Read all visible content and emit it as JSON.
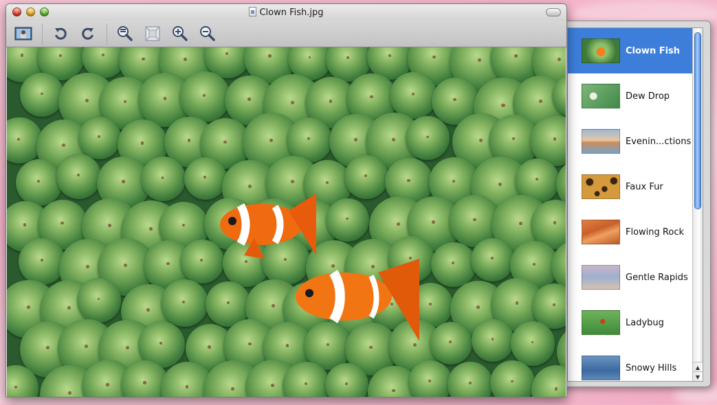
{
  "window": {
    "title": "Clown Fish.jpg"
  },
  "toolbar": {
    "buttons": [
      {
        "name": "slideshow-button",
        "icon": "photo-icon"
      },
      {
        "name": "rotate-left-button",
        "icon": "rotate-left-icon"
      },
      {
        "name": "rotate-right-button",
        "icon": "rotate-right-icon"
      },
      {
        "name": "actual-size-button",
        "icon": "zoom-actual-icon"
      },
      {
        "name": "zoom-to-fit-button",
        "icon": "zoom-fit-icon"
      },
      {
        "name": "zoom-in-button",
        "icon": "zoom-in-icon"
      },
      {
        "name": "zoom-out-button",
        "icon": "zoom-out-icon"
      }
    ]
  },
  "drawer": {
    "items": [
      {
        "label": "Clown Fish",
        "selected": true,
        "thumb": "clown-fish"
      },
      {
        "label": "Dew Drop",
        "selected": false,
        "thumb": "dew-drop"
      },
      {
        "label": "Evenin...ctions",
        "selected": false,
        "thumb": "evening"
      },
      {
        "label": "Faux Fur",
        "selected": false,
        "thumb": "faux-fur"
      },
      {
        "label": "Flowing Rock",
        "selected": false,
        "thumb": "flowing-rock"
      },
      {
        "label": "Gentle Rapids",
        "selected": false,
        "thumb": "gentle-rapids"
      },
      {
        "label": "Ladybug",
        "selected": false,
        "thumb": "ladybug"
      },
      {
        "label": "Snowy Hills",
        "selected": false,
        "thumb": "snowy-hills"
      }
    ]
  },
  "colors": {
    "selection": "#3d7edb",
    "scroll_knob": "#5b97e8"
  }
}
